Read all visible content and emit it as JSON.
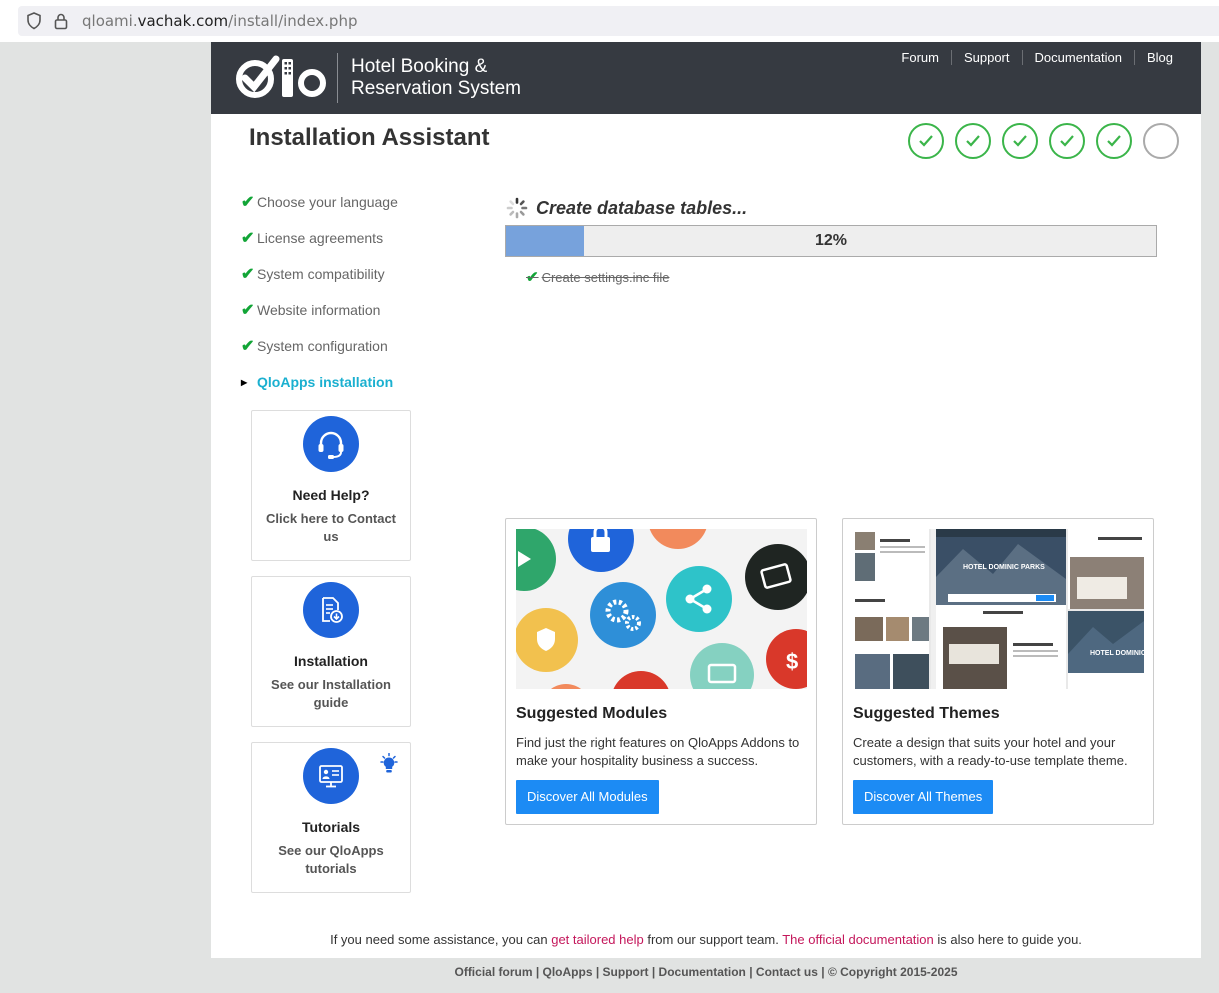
{
  "browser": {
    "url_prefix": "qloami.",
    "url_domain": "vachak.com",
    "url_path": "/install/index.php"
  },
  "header": {
    "tagline_line1": "Hotel Booking &",
    "tagline_line2": "Reservation System",
    "nav": [
      "Forum",
      "Support",
      "Documentation",
      "Blog"
    ]
  },
  "page_title": "Installation Assistant",
  "progress_steps": {
    "completed": 5,
    "total": 6
  },
  "sidebar": {
    "items": [
      {
        "label": "Choose your language",
        "done": true
      },
      {
        "label": "License agreements",
        "done": true
      },
      {
        "label": "System compatibility",
        "done": true
      },
      {
        "label": "Website information",
        "done": true
      },
      {
        "label": "System configuration",
        "done": true
      },
      {
        "label": "QloApps installation",
        "done": false
      }
    ]
  },
  "help_boxes": [
    {
      "title": "Need Help?",
      "text": "Click here to Contact us",
      "icon": "headset-icon"
    },
    {
      "title": "Installation",
      "text": "See our Installation guide",
      "icon": "document-download-icon"
    },
    {
      "title": "Tutorials",
      "text": "See our QloApps tutorials",
      "icon": "tutorial-board-icon"
    }
  ],
  "install": {
    "current_task": "Create database tables...",
    "progress_percent": 12,
    "progress_label": "12%",
    "completed_task": "Create settings.inc file"
  },
  "cards": {
    "modules": {
      "title": "Suggested Modules",
      "text": "Find just the right features on QloApps Addons to make your hospitality business a success.",
      "button": "Discover All Modules"
    },
    "themes": {
      "title": "Suggested Themes",
      "text": "Create a design that suits your hotel and your customers, with a ready-to-use template theme.",
      "button": "Discover All Themes"
    }
  },
  "assistance": {
    "part1": "If you need some assistance, you can ",
    "link1": "get tailored help",
    "part2": " from our support team. ",
    "link2": "The official documentation",
    "part3": " is also here to guide you."
  },
  "footer": "Official forum | QloApps | Support | Documentation | Contact us | © Copyright 2015-2025",
  "colors": {
    "header_bg": "#363a41",
    "step_done": "#3bb54a",
    "active_nav": "#1bb0d0",
    "button": "#1c8bf4",
    "link": "#c4175b",
    "progress_fill": "#77a2dc"
  }
}
